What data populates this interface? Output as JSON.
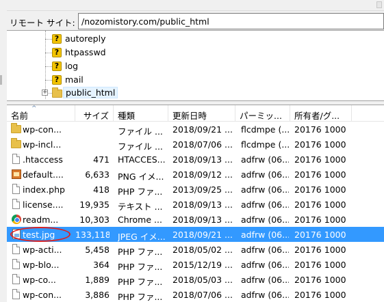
{
  "remote_site": {
    "label": "リモート サイト:",
    "path": "/nozomistory.com/public_html"
  },
  "tree": {
    "items": [
      {
        "label": "autoreply",
        "icon": "question-icon"
      },
      {
        "label": "htpasswd",
        "icon": "question-icon"
      },
      {
        "label": "log",
        "icon": "question-icon"
      },
      {
        "label": "mail",
        "icon": "question-icon"
      },
      {
        "label": "public_html",
        "icon": "folder-icon",
        "expander": "+"
      }
    ]
  },
  "columns": [
    "名前",
    "サイズ",
    "種類",
    "更新日時",
    "パーミッ...",
    "所有者/グ..."
  ],
  "sort_indicator": "^",
  "files": [
    {
      "name": "wp-con...",
      "size": "",
      "type": "ファイル ...",
      "modified": "2018/09/21 ...",
      "perm": "flcdmpe (...",
      "owner": "20176 1000",
      "icon": "folder-icon"
    },
    {
      "name": "wp-incl...",
      "size": "",
      "type": "ファイル ...",
      "modified": "2018/07/06 ...",
      "perm": "flcdmpe (...",
      "owner": "20176 1000",
      "icon": "folder-icon"
    },
    {
      "name": ".htaccess",
      "size": "471",
      "type": "HTACCES...",
      "modified": "2018/09/13 ...",
      "perm": "adfrw (06...",
      "owner": "20176 1000",
      "icon": "document-icon"
    },
    {
      "name": "default....",
      "size": "6,633",
      "type": "PNG イメ...",
      "modified": "2018/09/12 ...",
      "perm": "adfrw (06...",
      "owner": "20176 1000",
      "icon": "image-icon"
    },
    {
      "name": "index.php",
      "size": "418",
      "type": "PHP ファ...",
      "modified": "2013/09/25 ...",
      "perm": "adfrw (06...",
      "owner": "20176 1000",
      "icon": "document-icon"
    },
    {
      "name": "license....",
      "size": "19,935",
      "type": "テキスト ...",
      "modified": "2018/09/13 ...",
      "perm": "adfrw (06...",
      "owner": "20176 1000",
      "icon": "document-icon"
    },
    {
      "name": "readm...",
      "size": "10,303",
      "type": "Chrome ...",
      "modified": "2018/09/13 ...",
      "perm": "adfrw (06...",
      "owner": "20176 1000",
      "icon": "chrome-icon"
    },
    {
      "name": "test.jpg",
      "size": "133,118",
      "type": "JPEG イメ...",
      "modified": "2018/09/21 ...",
      "perm": "adfrw (06...",
      "owner": "20176 1000",
      "icon": "jpeg-icon",
      "selected": true,
      "circled": true
    },
    {
      "name": "wp-acti...",
      "size": "5,458",
      "type": "PHP ファ...",
      "modified": "2018/05/02 ...",
      "perm": "adfrw (06...",
      "owner": "20176 1000",
      "icon": "document-icon"
    },
    {
      "name": "wp-blo...",
      "size": "364",
      "type": "PHP ファ...",
      "modified": "2015/12/19 ...",
      "perm": "adfrw (06...",
      "owner": "20176 1000",
      "icon": "document-icon"
    },
    {
      "name": "wp-co...",
      "size": "1,889",
      "type": "PHP ファ...",
      "modified": "2018/05/03 ...",
      "perm": "adfrw (06...",
      "owner": "20176 1000",
      "icon": "document-icon"
    },
    {
      "name": "wp-con...",
      "size": "3,886",
      "type": "PHP ファ...",
      "modified": "2018/07/06 ...",
      "perm": "adfrw (06...",
      "owner": "20176 1000",
      "icon": "document-icon"
    }
  ],
  "colors": {
    "selection": "#3399ff",
    "highlight_circle": "#e0211d",
    "folder": "#e8c04a"
  }
}
